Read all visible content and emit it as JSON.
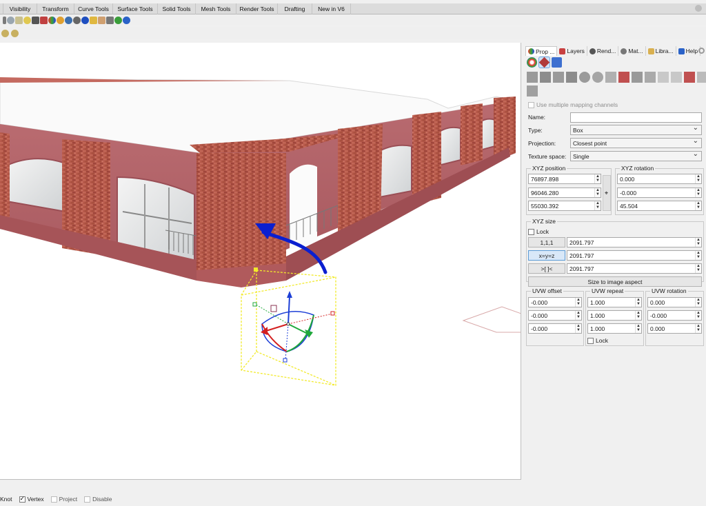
{
  "menu_tabs": [
    "Visibility",
    "Transform",
    "Curve Tools",
    "Surface Tools",
    "Solid Tools",
    "Mesh Tools",
    "Render Tools",
    "Drafting",
    "New in V6"
  ],
  "panel_tabs": [
    "Prop ...",
    "Layers",
    "Rend...",
    "Mat...",
    "Libra...",
    "Help"
  ],
  "mapping": {
    "multi_channel_label": "Use multiple mapping channels",
    "name_label": "Name:",
    "name_value": "",
    "type_label": "Type:",
    "type_value": "Box",
    "projection_label": "Projection:",
    "projection_value": "Closest point",
    "texture_space_label": "Texture space:",
    "texture_space_value": "Single"
  },
  "xyz_position": {
    "title": "XYZ position",
    "values": [
      "76897.898",
      "96046.280",
      "55030.392"
    ]
  },
  "xyz_rotation": {
    "title": "XYZ rotation",
    "values": [
      "0.000",
      "-0.000",
      "45.504"
    ]
  },
  "xyz_size": {
    "title": "XYZ size",
    "lock_label": "Lock",
    "buttons": [
      "1,1,1",
      "x=y=z",
      ">[ ]<"
    ],
    "values": [
      "2091.797",
      "2091.797",
      "2091.797"
    ],
    "aspect_button": "Size to image aspect"
  },
  "uvw_offset": {
    "title": "UVW offset",
    "values": [
      "-0.000",
      "-0.000",
      "-0.000"
    ]
  },
  "uvw_repeat": {
    "title": "UVW repeat",
    "values": [
      "1.000",
      "1.000",
      "1.000"
    ],
    "lock_label": "Lock"
  },
  "uvw_rotation": {
    "title": "UVW rotation",
    "values": [
      "0.000",
      "-0.000",
      "0.000"
    ]
  },
  "status": {
    "knot": "Knot",
    "vertex": "Vertex",
    "project": "Project",
    "disable": "Disable"
  },
  "colors": {
    "brick": "#b5574a",
    "plaster": "#b9696f",
    "gumball_blue": "#1d3fd6",
    "gumball_red": "#d32020",
    "gumball_green": "#1fa83a",
    "selection_yellow": "#f2ea2a",
    "annotation_arrow": "#0a1fd0"
  }
}
